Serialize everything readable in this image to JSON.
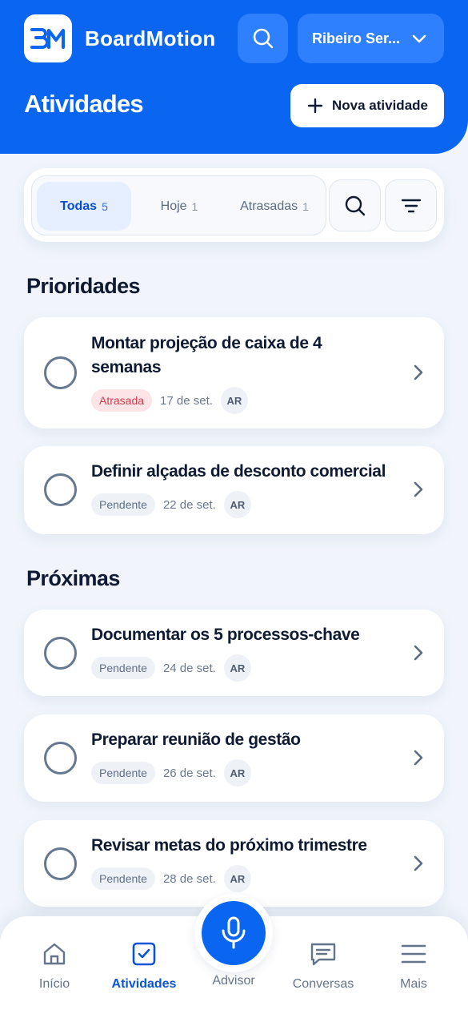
{
  "header": {
    "logo_text": "BM",
    "brand": "BoardMotion",
    "user_name": "Ribeiro Ser...",
    "title": "Atividades",
    "new_button_label": "Nova atividade"
  },
  "filters": {
    "tabs": [
      {
        "label": "Todas",
        "count": "5",
        "active": true
      },
      {
        "label": "Hoje",
        "count": "1",
        "active": false
      },
      {
        "label": "Atrasadas",
        "count": "1",
        "active": false
      }
    ]
  },
  "sections": {
    "priorities_title": "Prioridades",
    "upcoming_title": "Próximas"
  },
  "tasks": [
    {
      "title_line1": "Montar projeção de caixa de 4",
      "title_line2": "semanas",
      "status": "Atrasada",
      "date": "17 de set.",
      "assignee": "AR"
    },
    {
      "title": "Definir alçadas de desconto comercial",
      "status": "Pendente",
      "date": "22 de set.",
      "assignee": "AR"
    },
    {
      "title": "Documentar os 5 processos-chave",
      "status": "Pendente",
      "date": "24 de set.",
      "assignee": "AR"
    },
    {
      "title": "Preparar reunião de gestão",
      "status": "Pendente",
      "date": "26 de set.",
      "assignee": "AR"
    },
    {
      "title": "Revisar metas do próximo trimestre",
      "status": "Pendente",
      "date": "28 de set.",
      "assignee": "AR"
    }
  ],
  "nav": {
    "items": [
      {
        "label": "Início",
        "icon": "home-icon"
      },
      {
        "label": "Atividades",
        "icon": "checkbox-icon",
        "active": true
      },
      {
        "label": "Advisor",
        "icon": "mic-icon"
      },
      {
        "label": "Conversas",
        "icon": "chat-icon"
      },
      {
        "label": "Mais",
        "icon": "menu-icon"
      }
    ]
  },
  "colors": {
    "primary": "#0a66f0",
    "header_button": "#2f80ff",
    "late_badge_bg": "#fde4e6",
    "late_badge_text": "#d23b4a",
    "background": "#f1f5fb"
  }
}
